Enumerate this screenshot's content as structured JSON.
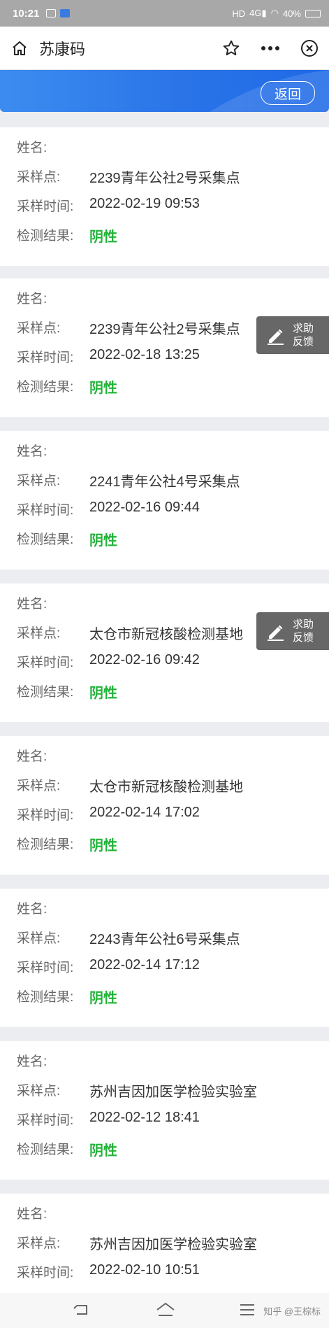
{
  "status_bar": {
    "time": "10:21",
    "battery": "40%"
  },
  "header": {
    "title": "苏康码"
  },
  "banner": {
    "back_label": "返回"
  },
  "labels": {
    "name": "姓名:",
    "site": "采样点:",
    "time": "采样时间:",
    "result": "检测结果:"
  },
  "feedback": {
    "line1": "求助",
    "line2": "反馈"
  },
  "records": [
    {
      "site": "2239青年公社2号采集点",
      "time": "2022-02-19 09:53",
      "result": "阴性"
    },
    {
      "site": "2239青年公社2号采集点",
      "time": "2022-02-18 13:25",
      "result": "阴性"
    },
    {
      "site": "2241青年公社4号采集点",
      "time": "2022-02-16 09:44",
      "result": "阴性"
    },
    {
      "site": "太仓市新冠核酸检测基地",
      "time": "2022-02-16 09:42",
      "result": "阴性"
    },
    {
      "site": "太仓市新冠核酸检测基地",
      "time": "2022-02-14 17:02",
      "result": "阴性"
    },
    {
      "site": "2243青年公社6号采集点",
      "time": "2022-02-14 17:12",
      "result": "阴性"
    },
    {
      "site": "苏州吉因加医学检验实验室",
      "time": "2022-02-12 18:41",
      "result": "阴性"
    },
    {
      "site": "苏州吉因加医学检验实验室",
      "time": "2022-02-10 10:51",
      "result": ""
    }
  ],
  "credit": "知乎 @王棕标"
}
